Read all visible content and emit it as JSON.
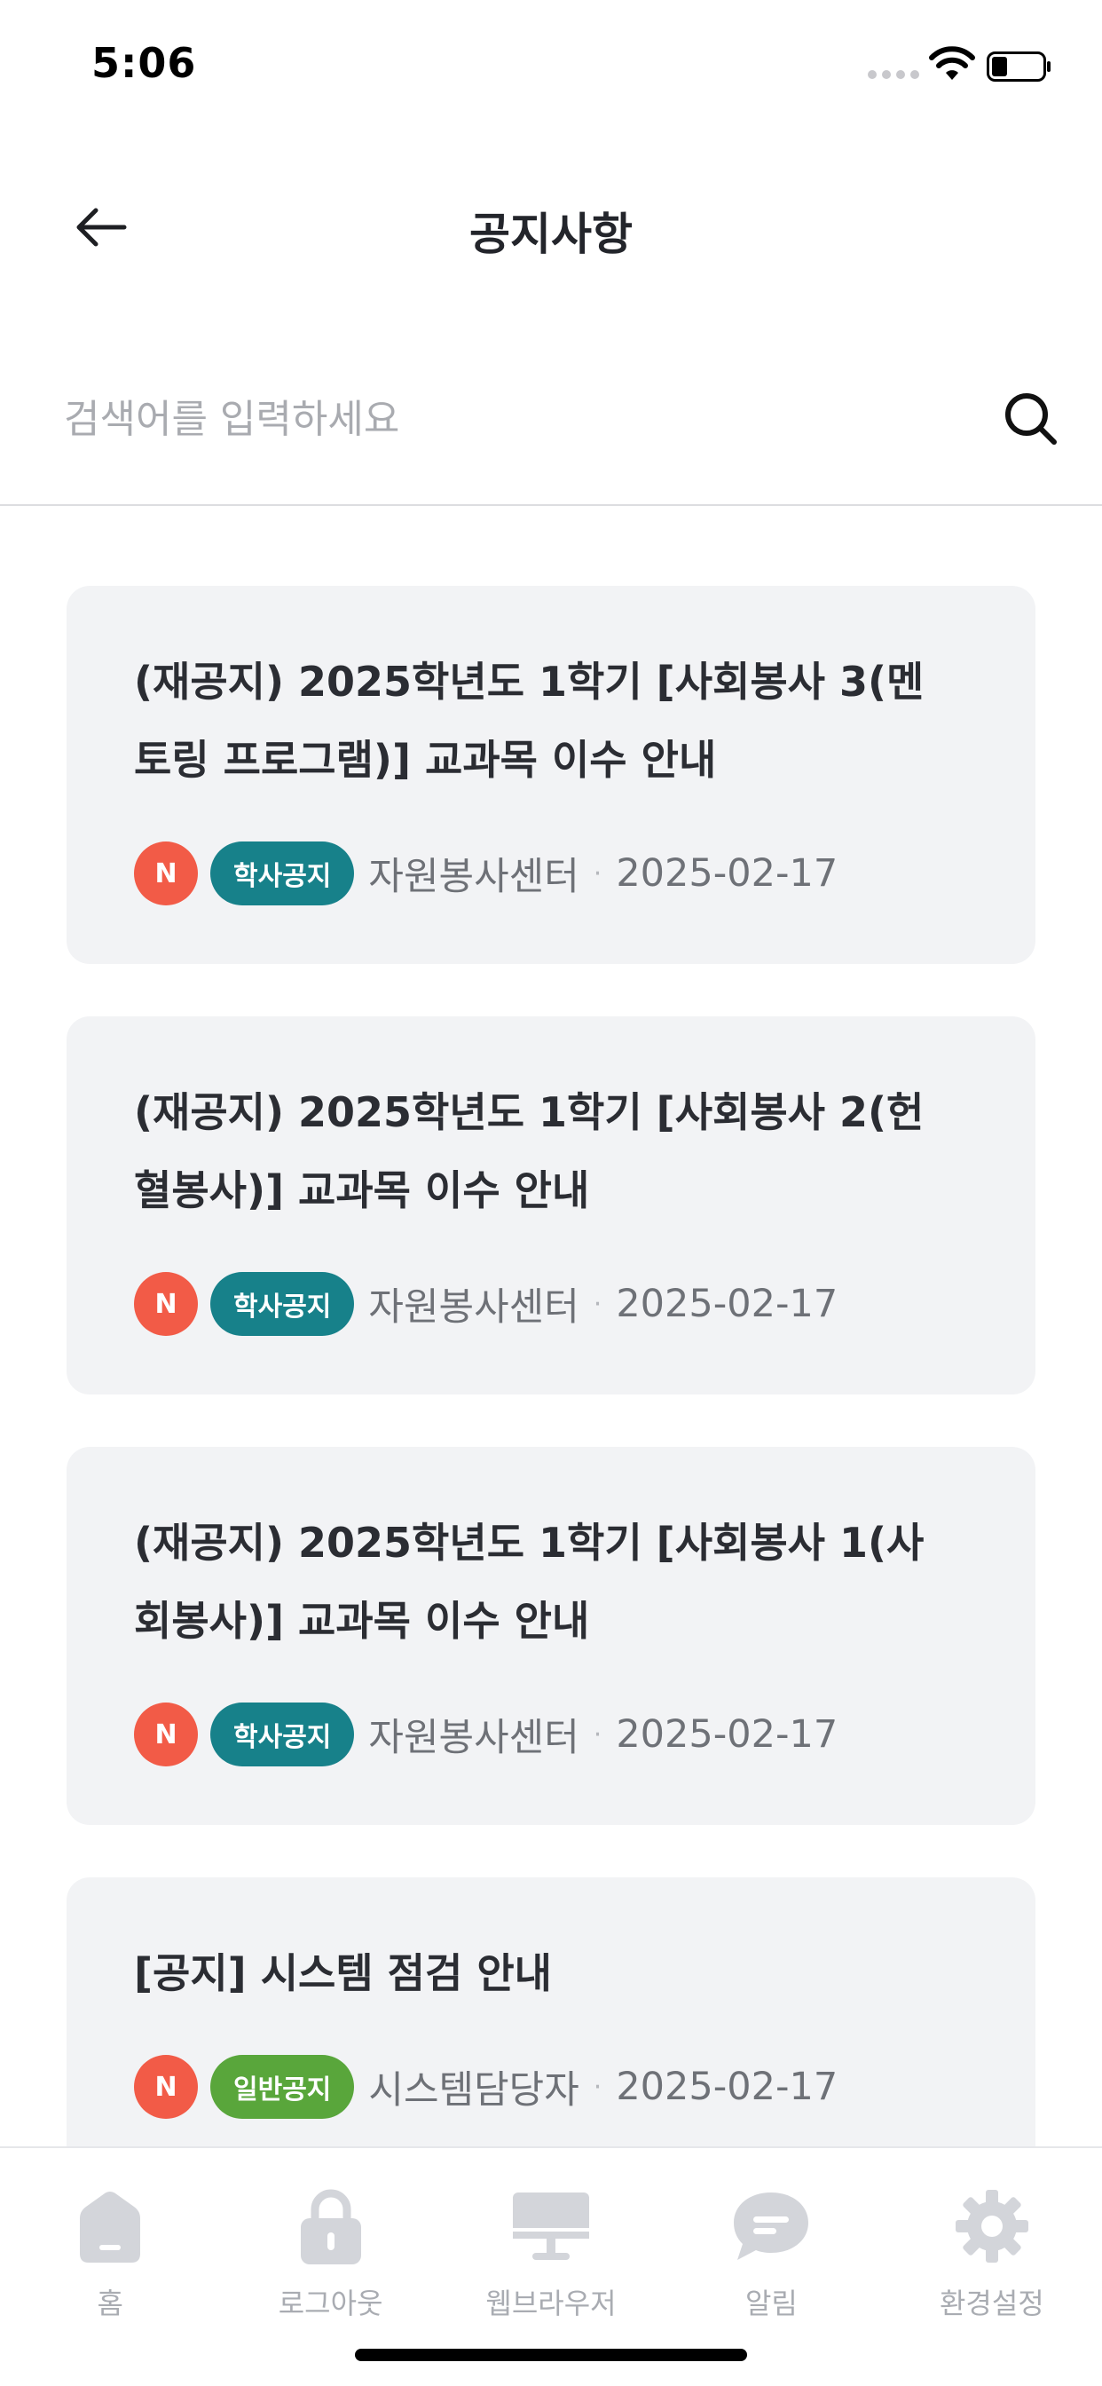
{
  "status_bar": {
    "time": "5:06"
  },
  "header": {
    "title": "공지사항"
  },
  "search": {
    "placeholder": "검색어를 입력하세요",
    "value": ""
  },
  "colors": {
    "new_badge": "#f25b47",
    "academic_badge": "#17818a",
    "general_badge": "#59a63b",
    "card_background": "#f2f3f5",
    "tab_icon": "#d3d5da"
  },
  "notices": [
    {
      "title_line1": "(재공지) 2025학년도 1학기 [사회봉사 3(멘",
      "title_line2": "토링 프로그램)] 교과목 이수 안내",
      "new_label": "N",
      "category": "학사공지",
      "author": "자원봉사센터",
      "separator": "·",
      "date": "2025-02-17"
    },
    {
      "title_line1": "(재공지) 2025학년도 1학기 [사회봉사 2(헌",
      "title_line2": "혈봉사)] 교과목 이수 안내",
      "new_label": "N",
      "category": "학사공지",
      "author": "자원봉사센터",
      "separator": "·",
      "date": "2025-02-17"
    },
    {
      "title_line1": "(재공지) 2025학년도 1학기 [사회봉사 1(사",
      "title_line2": "회봉사)] 교과목 이수 안내",
      "new_label": "N",
      "category": "학사공지",
      "author": "자원봉사센터",
      "separator": "·",
      "date": "2025-02-17"
    },
    {
      "title_line1": "[공지] 시스템 점검 안내",
      "new_label": "N",
      "category": "일반공지",
      "author": "시스템담당자",
      "separator": "·",
      "date": "2025-02-17"
    }
  ],
  "tab_bar": {
    "items": [
      {
        "label": "홈",
        "icon": "home-icon"
      },
      {
        "label": "로그아웃",
        "icon": "lock-icon"
      },
      {
        "label": "웹브라우저",
        "icon": "monitor-icon"
      },
      {
        "label": "알림",
        "icon": "chat-bubble-icon"
      },
      {
        "label": "환경설정",
        "icon": "gear-icon"
      }
    ]
  }
}
